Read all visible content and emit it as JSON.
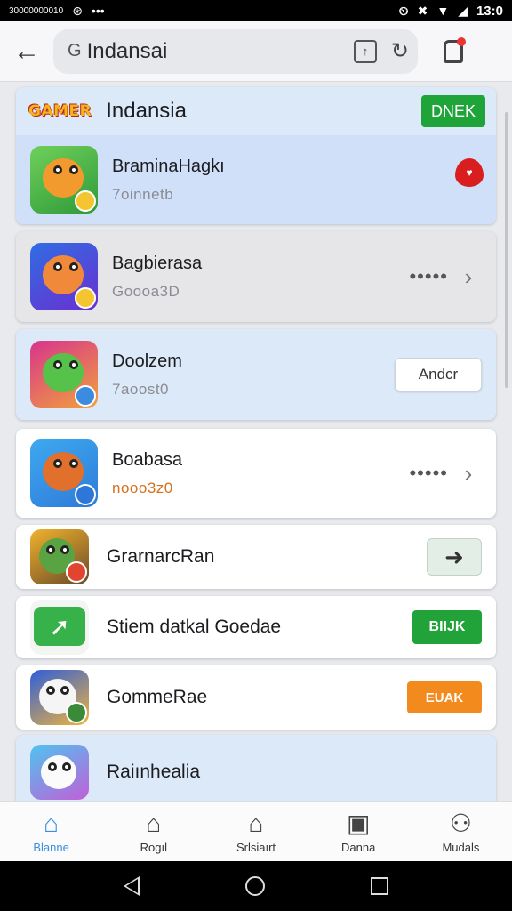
{
  "status_bar": {
    "left_text": "30000000010",
    "time": "13:0"
  },
  "top_bar": {
    "search_text": "Indansai",
    "search_prefix": "G"
  },
  "header": {
    "logo_text": "GAMER",
    "title": "Indansia",
    "open_label": "DNEK"
  },
  "apps": [
    {
      "title": "BraminaHagkı",
      "subtitle": "7oinnetb",
      "action": "heart"
    },
    {
      "title": "Bagbierasa",
      "subtitle": "Goooa3D",
      "action": "more"
    },
    {
      "title": "Doolzem",
      "subtitle": "7aoost0",
      "action": "add",
      "action_label": "Andcr"
    },
    {
      "title": "Boabasa",
      "subtitle": "nooo3z0",
      "action": "more"
    },
    {
      "title": "GrarnarcRan",
      "action": "arrow"
    },
    {
      "title": "Stiem datkal Goedae",
      "action": "green",
      "action_label": "BIIJK"
    },
    {
      "title": "GommeRae",
      "action": "orange",
      "action_label": "EUAK"
    },
    {
      "title": "Raiınhealia"
    }
  ],
  "bottom_nav": [
    {
      "label": "Blanne",
      "icon": "home-icon",
      "active": true
    },
    {
      "label": "Rogıl",
      "icon": "home-icon"
    },
    {
      "label": "Srlsiaırt",
      "icon": "home-icon"
    },
    {
      "label": "Danna",
      "icon": "book-icon"
    },
    {
      "label": "Mudals",
      "icon": "person-icon"
    }
  ],
  "colors": {
    "accent_blue": "#3a8fe0",
    "open_green": "#1fa43a",
    "heart_red": "#d81e1e",
    "orange": "#f28a1e"
  }
}
